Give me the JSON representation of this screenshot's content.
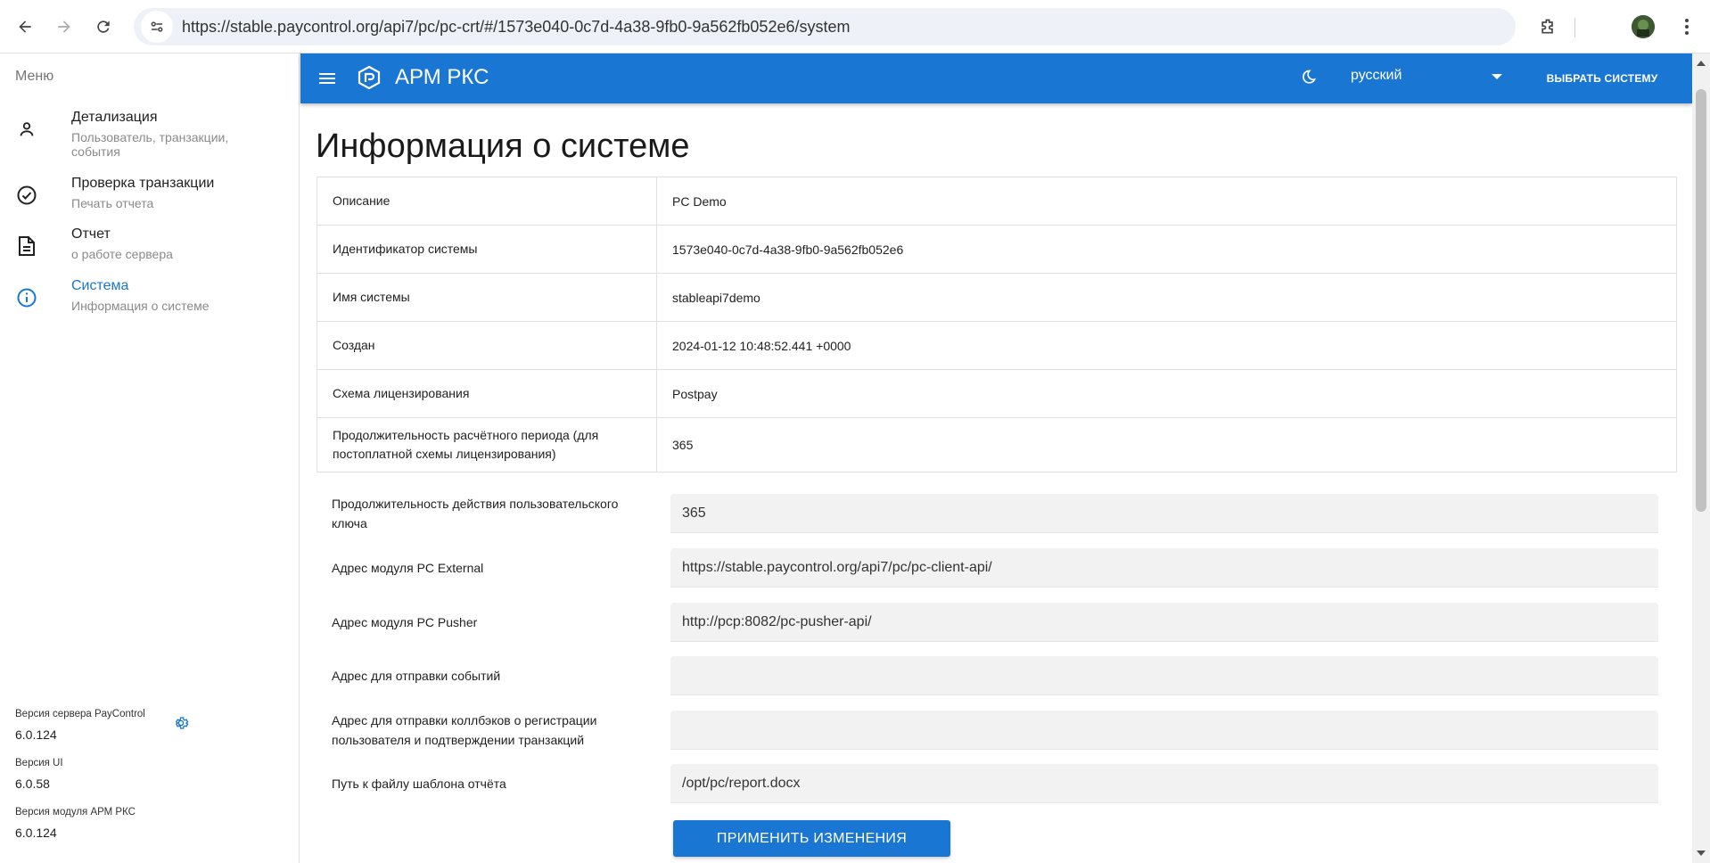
{
  "browser": {
    "url": "https://stable.paycontrol.org/api7/pc/pc-crt/#/1573e040-0c7d-4a38-9fb0-9a562fb052e6/system"
  },
  "sidebar": {
    "menu_title": "Меню",
    "items": [
      {
        "title": "Детализация",
        "subtitle": "Пользователь, транзакции, события",
        "icon": "person-icon"
      },
      {
        "title": "Проверка транзакции",
        "subtitle": "Печать отчета",
        "icon": "check-circle-icon"
      },
      {
        "title": "Отчет",
        "subtitle": "о работе сервера",
        "icon": "document-icon"
      },
      {
        "title": "Система",
        "subtitle": "Информация о системе",
        "icon": "info-icon"
      }
    ],
    "versions": {
      "server_label": "Версия сервера PayControl",
      "server_value": "6.0.124",
      "ui_label": "Версия UI",
      "ui_value": "6.0.58",
      "module_label": "Версия модуля АРМ РКС",
      "module_value": "6.0.124"
    }
  },
  "appbar": {
    "title": "АРМ РКС",
    "language": "русский",
    "choose_system": "ВЫБРАТЬ СИСТЕМУ"
  },
  "main": {
    "page_title": "Информация о системе",
    "info": [
      {
        "key": "Описание",
        "value": "PC Demo"
      },
      {
        "key": "Идентификатор системы",
        "value": "1573e040-0c7d-4a38-9fb0-9a562fb052e6"
      },
      {
        "key": "Имя системы",
        "value": "stableapi7demo"
      },
      {
        "key": "Создан",
        "value": "2024-01-12 10:48:52.441 +0000"
      },
      {
        "key": "Схема лицензирования",
        "value": "Postpay"
      },
      {
        "key": "Продолжительность расчётного периода (для постоплатной схемы лицензирования)",
        "value": "365"
      }
    ],
    "form": [
      {
        "label": "Продолжительность действия пользовательского ключа",
        "value": "365"
      },
      {
        "label": "Адрес модуля PC External",
        "value": "https://stable.paycontrol.org/api7/pc/pc-client-api/"
      },
      {
        "label": "Адрес модуля PC Pusher",
        "value": "http://pcp:8082/pc-pusher-api/"
      },
      {
        "label": "Адрес для отправки событий",
        "value": ""
      },
      {
        "label": "Адрес для отправки коллбэков о регистрации пользователя и подтверждении транзакций",
        "value": ""
      },
      {
        "label": "Путь к файлу шаблона отчёта",
        "value": "/opt/pc/report.docx"
      }
    ],
    "apply_button": "ПРИМЕНИТЬ ИЗМЕНЕНИЯ"
  },
  "colors": {
    "primary": "#1976d2"
  }
}
